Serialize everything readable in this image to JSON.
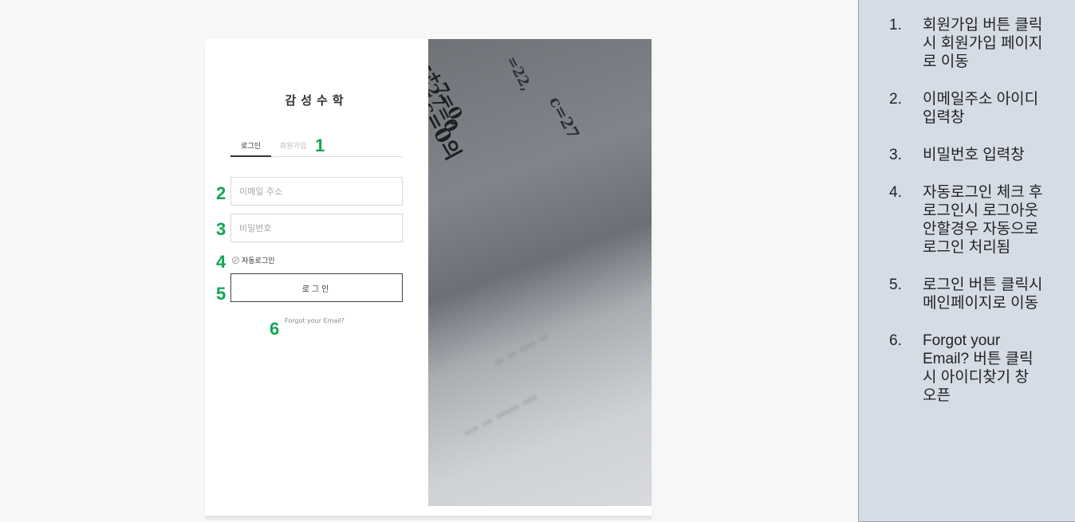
{
  "brand": {
    "title": "감성수학"
  },
  "tabs": {
    "login": "로그인",
    "signup": "회원가입"
  },
  "form": {
    "email_placeholder": "이메일 주소",
    "password_placeholder": "비밀번호",
    "auto_login_label": "자동로그인",
    "auto_login_checked": true,
    "login_button": "로그인",
    "forgot_link": "Forgot your Email?"
  },
  "markers": [
    "1",
    "2",
    "3",
    "4",
    "5",
    "6"
  ],
  "image": {
    "math_lines": [
      "-+7=0,",
      "+27=0",
      "c=0의",
      "=22,",
      "c=27"
    ]
  },
  "notes": [
    {
      "num": "1.",
      "text": "회원가입 버튼 클릭시 회원가입 페이지로 이동"
    },
    {
      "num": "2.",
      "text": "이메일주소 아이디 입력창"
    },
    {
      "num": "3.",
      "text": "비밀번호 입력창"
    },
    {
      "num": "4.",
      "text": "자동로그인 체크 후 로그인시 로그아웃 안할경우 자동으로 로그인 처리됨"
    },
    {
      "num": "5.",
      "text": "로그인 버튼 클릭시 메인페이지로 이동"
    },
    {
      "num": "6.",
      "text": "Forgot your Email? 버튼 클릭시 아이디찾기 창 오픈"
    }
  ],
  "colors": {
    "marker_green": "#11a451",
    "notes_bg": "#d5dce6",
    "page_bg": "#f7f7f7"
  }
}
